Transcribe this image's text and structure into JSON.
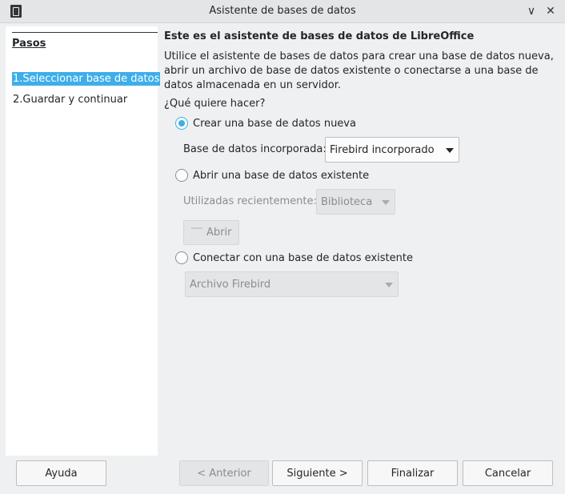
{
  "window": {
    "title": "Asistente de bases de datos",
    "minimize_glyph": "∨",
    "close_glyph": "✕"
  },
  "steps": {
    "title": "Pasos",
    "items": [
      {
        "label": "1.Seleccionar base de datos",
        "selected": true
      },
      {
        "label": "2.Guardar y continuar",
        "selected": false
      }
    ]
  },
  "main": {
    "heading": "Este es el asistente de bases de datos de LibreOffice",
    "intro": "Utilice el asistente de bases de datos para crear una base de datos nueva, abrir un archivo de base de datos existente o conectarse a una base de datos almacenada en un servidor.",
    "question": "¿Qué quiere hacer?",
    "option_create": {
      "label": "Crear una base de datos nueva",
      "checked": true
    },
    "embedded_label": "Base de datos incorporada:",
    "embedded_value": "Firebird incorporado",
    "option_open": {
      "label": "Abrir una base de datos existente",
      "checked": false
    },
    "recent_label": "Utilizadas recientemente:",
    "recent_value": "Biblioteca",
    "open_button": "Abrir",
    "option_connect": {
      "label": "Conectar con una base de datos existente",
      "checked": false
    },
    "connect_value": "Archivo Firebird"
  },
  "buttons": {
    "help": "Ayuda",
    "previous": "< Anterior",
    "next": "Siguiente >",
    "finish": "Finalizar",
    "cancel": "Cancelar"
  },
  "colors": {
    "accent": "#3daee9",
    "background": "#eff0f1",
    "panel": "#ffffff"
  }
}
